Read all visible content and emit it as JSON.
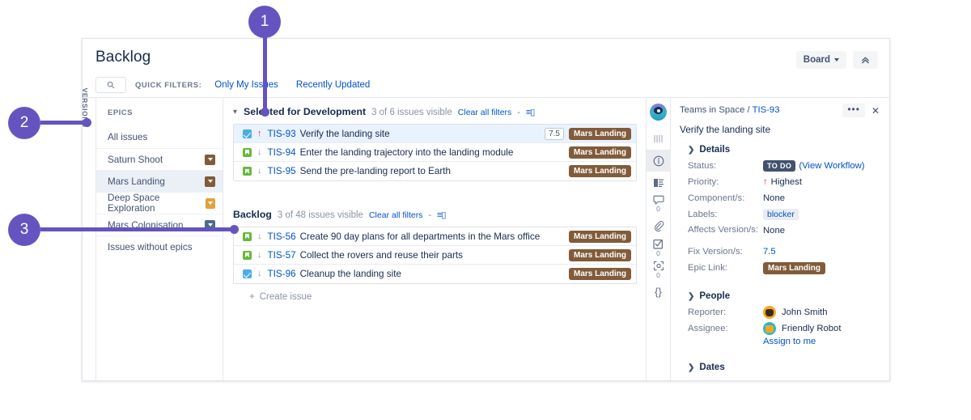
{
  "callouts": [
    {
      "number": "1",
      "target": "selected-for-development-header"
    },
    {
      "number": "2",
      "target": "versions-rail"
    },
    {
      "number": "3",
      "target": "backlog-section-header"
    }
  ],
  "header": {
    "board_title": "Backlog",
    "board_button_label": "Board",
    "collapse_button_icon": "double-chevron-up-icon"
  },
  "quick_filters": {
    "search_icon": "search-icon",
    "label": "QUICK FILTERS:",
    "filters": [
      {
        "label": "Only My Issues"
      },
      {
        "label": "Recently Updated"
      }
    ]
  },
  "versions_rail": {
    "label": "VERSIONS"
  },
  "epics_panel": {
    "heading": "EPICS",
    "items": [
      {
        "label": "All issues",
        "swatch": null,
        "selected": false
      },
      {
        "label": "Saturn Shoot",
        "swatch": "#815B3A",
        "selected": false
      },
      {
        "label": "Mars Landing",
        "swatch": "#815B3A",
        "selected": true
      },
      {
        "label": "Deep Space Exploration",
        "swatch": "#E2A13B",
        "selected": false
      },
      {
        "label": "Mars Colonisation",
        "swatch": "#4C6B8A",
        "selected": false
      },
      {
        "label": "Issues without epics",
        "swatch": null,
        "selected": false
      }
    ]
  },
  "sections": [
    {
      "title": "Selected for Development",
      "count_text": "3 of 6 issues visible",
      "clear_label": "Clear all filters",
      "dash": "-",
      "config_icon": "list-config-icon",
      "issues": [
        {
          "type": "task",
          "type_icon": "task-checkbox-icon",
          "priority": "highest",
          "priority_icon": "arrow-up-icon",
          "priority_glyph": "↑",
          "key": "TIS-93",
          "summary": "Verify the landing site",
          "estimate": "7.5",
          "epic": "Mars Landing",
          "epic_color": "#815B3A",
          "active": true
        },
        {
          "type": "story",
          "type_icon": "story-bookmark-icon",
          "priority": "low",
          "priority_icon": "arrow-down-icon",
          "priority_glyph": "↓",
          "key": "TIS-94",
          "summary": "Enter the landing trajectory into the landing module",
          "estimate": null,
          "epic": "Mars Landing",
          "epic_color": "#815B3A",
          "active": false
        },
        {
          "type": "story",
          "type_icon": "story-bookmark-icon",
          "priority": "low",
          "priority_icon": "arrow-down-icon",
          "priority_glyph": "↓",
          "key": "TIS-95",
          "summary": "Send the pre-landing report to Earth",
          "estimate": null,
          "epic": "Mars Landing",
          "epic_color": "#815B3A",
          "active": false
        }
      ]
    },
    {
      "title": "Backlog",
      "count_text": "3 of 48 issues visible",
      "clear_label": "Clear all filters",
      "dash": "-",
      "config_icon": "list-config-icon",
      "issues": [
        {
          "type": "story",
          "type_icon": "story-bookmark-icon",
          "priority": "low",
          "priority_icon": "arrow-down-icon",
          "priority_glyph": "↓",
          "key": "TIS-56",
          "summary": "Create 90 day plans for all departments in the Mars office",
          "estimate": null,
          "epic": "Mars Landing",
          "epic_color": "#815B3A",
          "active": false
        },
        {
          "type": "story",
          "type_icon": "story-bookmark-icon",
          "priority": "low",
          "priority_icon": "arrow-down-icon",
          "priority_glyph": "↓",
          "key": "TIS-57",
          "summary": "Collect the rovers and reuse their parts",
          "estimate": null,
          "epic": "Mars Landing",
          "epic_color": "#815B3A",
          "active": false
        },
        {
          "type": "task",
          "type_icon": "task-checkbox-icon",
          "priority": "low",
          "priority_icon": "arrow-down-icon",
          "priority_glyph": "↓",
          "key": "TIS-96",
          "summary": "Cleanup the landing site",
          "estimate": null,
          "epic": "Mars Landing",
          "epic_color": "#815B3A",
          "active": false
        }
      ],
      "create_issue_label": "Create issue",
      "create_issue_icon": "plus-icon"
    }
  ],
  "detail_panel": {
    "icon_rail": [
      {
        "icon": "avatar-icon",
        "count": null,
        "active": false
      },
      {
        "icon": "bars-icon",
        "glyph": "||||",
        "count": null,
        "active": false
      },
      {
        "icon": "info-icon",
        "glyph": "ⓘ",
        "count": null,
        "active": true
      },
      {
        "icon": "description-icon",
        "glyph": "▤",
        "count": null,
        "active": false
      },
      {
        "icon": "comment-icon",
        "glyph": "🗨",
        "count": "0",
        "active": false
      },
      {
        "icon": "attachment-icon",
        "glyph": "📎",
        "count": null,
        "active": false
      },
      {
        "icon": "checklist-icon",
        "glyph": "☑",
        "count": "0",
        "active": false
      },
      {
        "icon": "screenshot-icon",
        "glyph": "⛶",
        "count": "0",
        "active": false
      },
      {
        "icon": "code-braces-icon",
        "glyph": "{}",
        "count": null,
        "active": false
      }
    ],
    "project_name": "Teams in Space",
    "breadcrumb_separator": "/",
    "issue_key": "TIS-93",
    "more_actions_icon": "ellipsis-icon",
    "close_icon": "close-icon",
    "summary": "Verify the landing site",
    "details_section": {
      "title": "Details",
      "chevron_icon": "chevron-right-icon",
      "fields": [
        {
          "label": "Status:",
          "value": "TO DO",
          "type": "status",
          "extra": "(View Workflow)"
        },
        {
          "label": "Priority:",
          "value": "Highest",
          "type": "priority",
          "icon": "arrow-up-icon",
          "glyph": "↑"
        },
        {
          "label": "Component/s:",
          "value": "None",
          "type": "text"
        },
        {
          "label": "Labels:",
          "value": "blocker",
          "type": "chip"
        },
        {
          "label": "Affects Version/s:",
          "value": "None",
          "type": "text"
        },
        {
          "label": "Fix Version/s:",
          "value": "7.5",
          "type": "link"
        },
        {
          "label": "Epic Link:",
          "value": "Mars Landing",
          "type": "epic",
          "epic_color": "#815B3A"
        }
      ]
    },
    "people_section": {
      "title": "People",
      "chevron_icon": "chevron-right-icon",
      "fields": [
        {
          "label": "Reporter:",
          "value": "John Smith",
          "avatar": "john"
        },
        {
          "label": "Assignee:",
          "value": "Friendly Robot",
          "avatar": "robot"
        }
      ],
      "assign_to_me_label": "Assign to me"
    },
    "dates_section": {
      "title": "Dates",
      "chevron_icon": "chevron-right-icon"
    }
  }
}
